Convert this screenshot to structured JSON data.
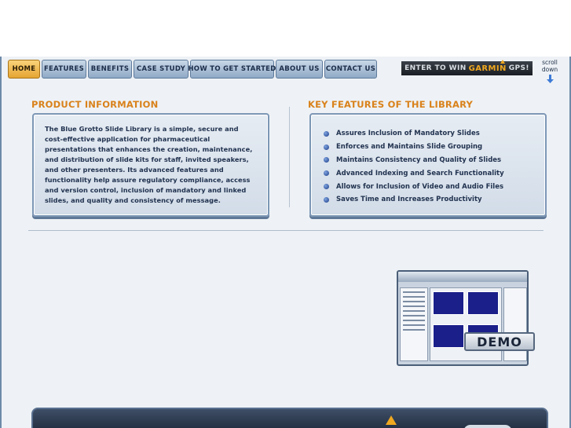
{
  "nav": {
    "tabs": [
      {
        "label": "HOME",
        "active": true
      },
      {
        "label": "FEATURES",
        "active": false
      },
      {
        "label": "BENEFITS",
        "active": false
      },
      {
        "label": "CASE STUDY",
        "active": false
      },
      {
        "label": "HOW TO GET STARTED",
        "active": false
      },
      {
        "label": "ABOUT US",
        "active": false
      },
      {
        "label": "CONTACT US",
        "active": false
      }
    ]
  },
  "promo": {
    "pre": "ENTER TO WIN",
    "brand": "GARMIN",
    "post": "GPS!"
  },
  "scroll": {
    "label": "scroll down"
  },
  "product": {
    "heading": "PRODUCT INFORMATION",
    "description": "The Blue Grotto Slide Library is a simple, secure and cost-effective application for pharmaceutical presentations that enhances the creation, maintenance, and distribution of slide kits for staff, invited speakers, and other presenters. Its advanced features and functionality help assure regulatory compliance, access and version control, inclusion of mandatory and linked slides, and quality and consistency of message."
  },
  "features": {
    "heading": "KEY FEATURES OF THE LIBRARY",
    "items": [
      "Assures Inclusion of Mandatory Slides",
      "Enforces and Maintains Slide Grouping",
      "Maintains Consistency and Quality of Slides",
      "Advanced Indexing and Search Functionality",
      "Allows for Inclusion of Video and Audio Files",
      "Saves Time and Increases Productivity"
    ]
  },
  "demo": {
    "label": "DEMO"
  },
  "colors": {
    "accent": "#d9821b",
    "panel_border": "#7d97b6",
    "text": "#223350"
  }
}
